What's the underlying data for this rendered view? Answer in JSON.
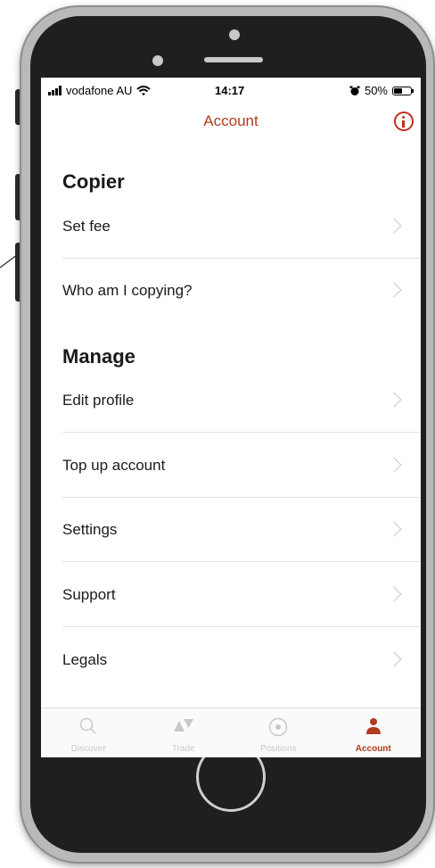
{
  "status_bar": {
    "carrier": "vodafone AU",
    "time": "14:17",
    "battery": "50%"
  },
  "header": {
    "title": "Account",
    "info_icon": "info-circle-icon"
  },
  "sections": [
    {
      "title": "Copier",
      "items": [
        {
          "label": "Set fee"
        },
        {
          "label": "Who am I copying?"
        }
      ]
    },
    {
      "title": "Manage",
      "items": [
        {
          "label": "Edit profile"
        },
        {
          "label": "Top up account"
        },
        {
          "label": "Settings"
        },
        {
          "label": "Support"
        },
        {
          "label": "Legals"
        }
      ]
    }
  ],
  "tabbar": {
    "tabs": [
      {
        "label": "Discover",
        "icon": "search-icon",
        "active": false
      },
      {
        "label": "Trade",
        "icon": "trade-icon",
        "active": false
      },
      {
        "label": "Positions",
        "icon": "positions-icon",
        "active": false
      },
      {
        "label": "Account",
        "icon": "person-icon",
        "active": true
      }
    ]
  },
  "colors": {
    "accent": "#b23a1e",
    "inactive": "#c8c8c8",
    "phone_body": "#1f1f1f",
    "phone_frame": "#b9b9b9"
  }
}
